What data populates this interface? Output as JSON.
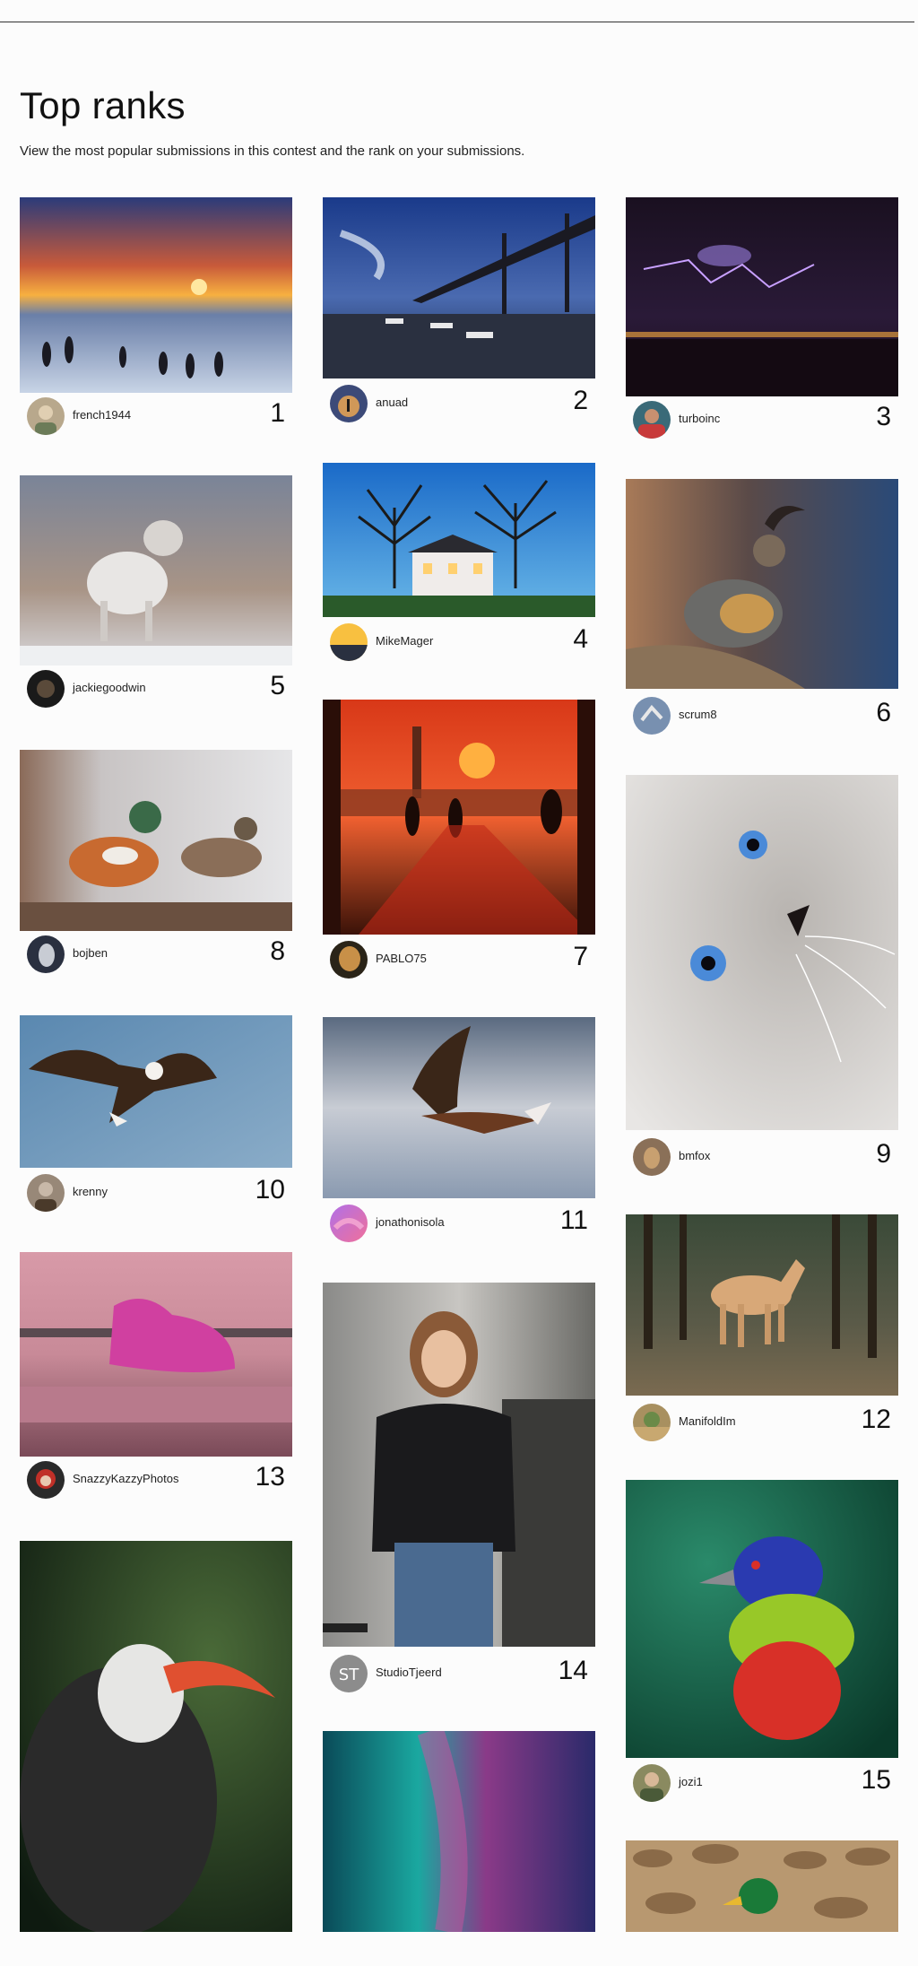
{
  "page": {
    "title": "Top ranks",
    "subtitle": "View the most popular submissions in this contest and the rank on your submissions."
  },
  "entries": [
    {
      "rank": "1",
      "user": "french1944",
      "photo": "sunset-penguins-photo",
      "avatar_color": "#b8a88c"
    },
    {
      "rank": "2",
      "user": "anuad",
      "photo": "bridge-harbor-photo",
      "avatar_color": "#3c4a78"
    },
    {
      "rank": "3",
      "user": "turboinc",
      "photo": "lightning-night-photo",
      "avatar_color": "#6a4a40"
    },
    {
      "rank": "4",
      "user": "MikeMager",
      "photo": "house-trees-photo",
      "avatar_color": "#e8a030"
    },
    {
      "rank": "5",
      "user": "jackiegoodwin",
      "photo": "arctic-fox-photo",
      "avatar_color": "#1a1a1a"
    },
    {
      "rank": "6",
      "user": "scrum8",
      "photo": "quail-photo",
      "avatar_color": "#7890b0"
    },
    {
      "rank": "7",
      "user": "PABLO75",
      "photo": "red-sunset-street-photo",
      "avatar_color": "#c89048"
    },
    {
      "rank": "8",
      "user": "bojben",
      "photo": "mandarin-ducks-photo",
      "avatar_color": "#2a3040"
    },
    {
      "rank": "9",
      "user": "bmfox",
      "photo": "blue-eyed-cat-photo",
      "avatar_color": "#8a7058"
    },
    {
      "rank": "10",
      "user": "krenny",
      "photo": "bald-eagle-photo",
      "avatar_color": "#988878"
    },
    {
      "rank": "11",
      "user": "jonathonisola",
      "photo": "hawk-flight-photo",
      "avatar_color": "#c070d8"
    },
    {
      "rank": "12",
      "user": "ManifoldIm",
      "photo": "palomino-horse-photo",
      "avatar_color": "#a89060"
    },
    {
      "rank": "13",
      "user": "SnazzyKazzyPhotos",
      "photo": "pink-dress-photo",
      "avatar_color": "#c03028"
    },
    {
      "rank": "14",
      "user": "StudioTjeerd",
      "avatar_text": "ST",
      "photo": "girl-leather-jacket-photo",
      "avatar_color": "#8c8c8c"
    },
    {
      "rank": "15",
      "user": "jozi1",
      "photo": "painted-bunting-photo",
      "avatar_color": "#8a8a60"
    },
    {
      "photo": "hornbill-photo"
    },
    {
      "photo": "aurora-photo"
    },
    {
      "photo": "mallard-pebbles-photo"
    }
  ],
  "colors": {
    "background": "#fcfcfc",
    "text": "#111111"
  }
}
